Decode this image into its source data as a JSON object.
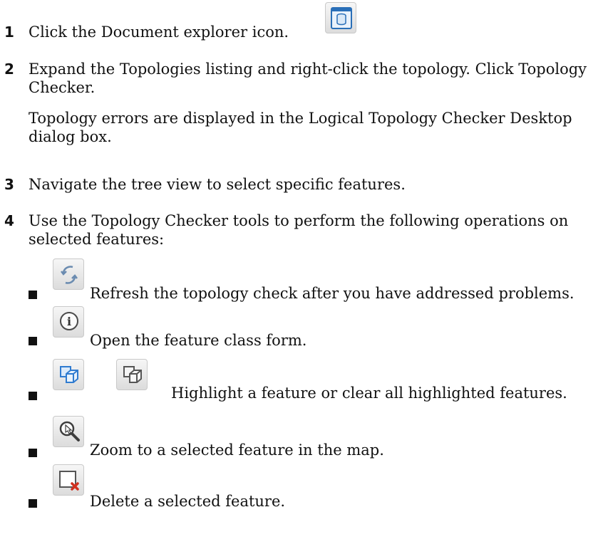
{
  "steps": [
    {
      "num": "1",
      "text": "Click the Document explorer icon."
    },
    {
      "num": "2",
      "line1": "Expand the Topologies listing and right-click the topology. Click Topology",
      "line2": "Checker.",
      "note1": "Topology errors are displayed in the Logical Topology Checker Desktop",
      "note2": "dialog box."
    },
    {
      "num": "3",
      "text": "Navigate the tree view to select specific features."
    },
    {
      "num": "4",
      "line1": "Use the Topology Checker tools to perform the following operations on",
      "line2": "selected features:"
    }
  ],
  "tools": [
    {
      "icon": "refresh-icon",
      "text": "Refresh the topology check after you have addressed problems."
    },
    {
      "icon": "info-icon",
      "text": "Open the feature class form."
    },
    {
      "icons": [
        "highlight-feature-icon",
        "clear-highlight-icon"
      ],
      "text": "Highlight a feature or clear all highlighted features."
    },
    {
      "icon": "zoom-to-feature-icon",
      "text": "Zoom to a selected feature in the map."
    },
    {
      "icon": "delete-feature-icon",
      "text": "Delete a selected feature."
    }
  ]
}
